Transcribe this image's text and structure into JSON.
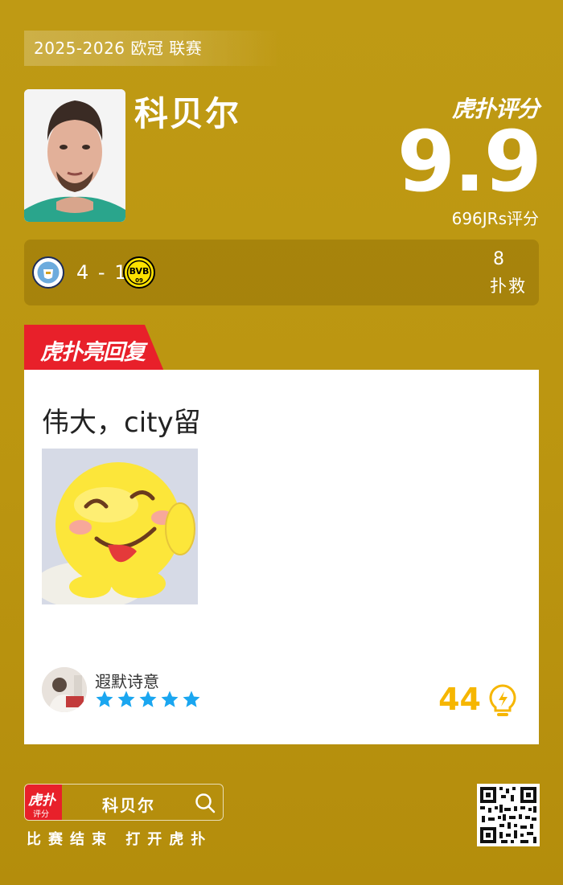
{
  "header": {
    "season_tag": "2025-2026 欧冠 联赛",
    "player_name": "科贝尔",
    "brand": "虎扑评分",
    "rating": "9.9",
    "rating_count": "696JRs评分"
  },
  "match": {
    "home_team_icon": "manchester-city-badge",
    "away_team_icon": "borussia-dortmund-badge",
    "score": "4 - 1",
    "stat_value": "8",
    "stat_label": "扑救"
  },
  "highlight": {
    "tab_label": "虎扑亮回复",
    "reply_text": "伟大，city留",
    "reply_image_icon": "smiling-emoji-sticker",
    "username": "遐默诗意",
    "stars": 5,
    "like_count": "44"
  },
  "footer": {
    "app_icon_text": "虎扑",
    "app_icon_sub": "评分",
    "search_keyword": "科贝尔",
    "caption": "比赛结束 打开虎扑"
  },
  "colors": {
    "background": "#bf9a14",
    "accent_red": "#e8202a",
    "like_orange": "#f6b600",
    "star_blue": "#1aa6f0"
  }
}
